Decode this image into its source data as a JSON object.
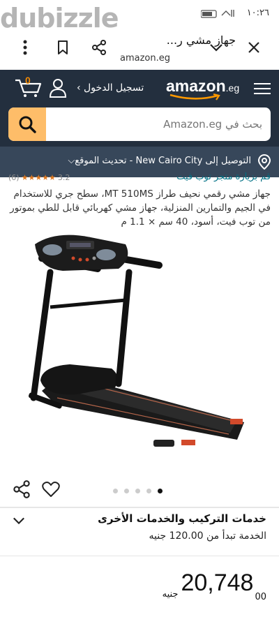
{
  "status_bar": {
    "time": "١٠:٢٦",
    "watermark_text": "dubizzle"
  },
  "browser": {
    "tab_title": "جهاز مشي ر...",
    "url": "amazon.eg"
  },
  "amazon_header": {
    "logo_text": "amazon",
    "logo_suffix": ".eg",
    "signin_label": "تسجيل الدخول ›",
    "cart_count": "0",
    "search_placeholder": "بحث في Amazon.eg",
    "delivery_text": "التوصيل إلى New Cairo City - تحديث الموقع⌵"
  },
  "product": {
    "store_link": "قم بزيارة متجر توب فيت",
    "rating_value": "3.2",
    "rating_count": "(6)",
    "title": "جهاز مشي رقمي نحيف طراز MT 510MS، سطح جري للاستخدام في الجيم والتمارين المنزلية، جهاز مشي كهربائي قابل للطي بموتور من توب فيت، أسود، 40 سم × 1.1 م",
    "image_icon": "treadmill-image"
  },
  "carousel": {
    "total": 5,
    "active_index": 4
  },
  "services": {
    "title": "خدمات التركيب والخدمات الأخرى",
    "subtitle": "الخدمة تبدأ من 120.00 جنيه"
  },
  "price": {
    "currency": "جنيه",
    "whole": "20,748",
    "fraction": "00"
  },
  "colors": {
    "header_bg": "#232f3e",
    "delivery_bg": "#37475a",
    "search_button": "#febd69",
    "star_color": "#de7921",
    "link_color": "#007185"
  }
}
